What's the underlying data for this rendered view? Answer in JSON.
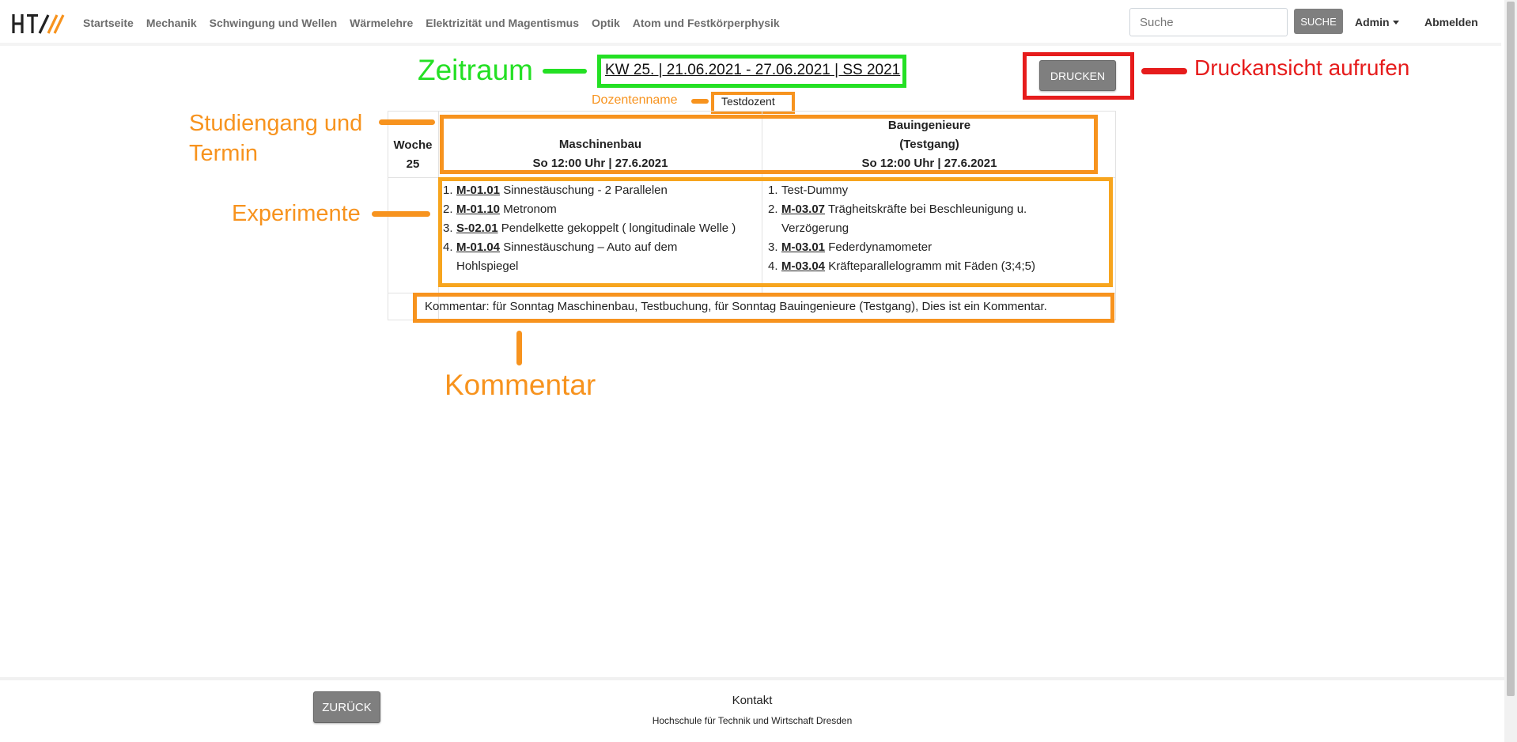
{
  "nav": {
    "links": [
      "Startseite",
      "Mechanik",
      "Schwingung und Wellen",
      "Wärmelehre",
      "Elektrizität und Magentismus",
      "Optik",
      "Atom und Festkörperphysik"
    ],
    "search_placeholder": "Suche",
    "search_button": "SUCHE",
    "admin": "Admin",
    "logout": "Abmelden"
  },
  "header": {
    "zeitraum": "KW 25. | 21.06.2021 - 27.06.2021 | SS 2021",
    "print_button": "DRUCKEN",
    "dozent": "Testdozent"
  },
  "annotations": {
    "zeitraum": "Zeitraum",
    "druck": "Druckansicht aufrufen",
    "dozentenname": "Dozentenname",
    "studiengang_1": "Studiengang und",
    "studiengang_2": "Termin",
    "experimente": "Experimente",
    "kommentar": "Kommentar"
  },
  "table": {
    "week_label": "Woche",
    "week_number": "25",
    "columns": [
      {
        "name_lines": [
          "",
          "Maschinenbau"
        ],
        "termin": "So 12:00 Uhr | 27.6.2021",
        "experiments": [
          {
            "num": "1.",
            "code": "M-01.01",
            "title": "Sinnestäuschung - 2 Parallelen"
          },
          {
            "num": "2.",
            "code": "M-01.10",
            "title": "Metronom"
          },
          {
            "num": "3.",
            "code": "S-02.01",
            "title": "Pendelkette gekoppelt ( longitudinale Welle )"
          },
          {
            "num": "4.",
            "code": "M-01.04",
            "title": "Sinnestäuschung – Auto auf dem Hohlspiegel"
          }
        ]
      },
      {
        "name_lines": [
          "Bauingenieure",
          "(Testgang)"
        ],
        "termin": "So 12:00 Uhr | 27.6.2021",
        "experiments": [
          {
            "num": "1.",
            "code": "",
            "title": "Test-Dummy"
          },
          {
            "num": "2.",
            "code": "M-03.07",
            "title": "Trägheitskräfte bei Beschleunigung u. Verzögerung"
          },
          {
            "num": "3.",
            "code": "M-03.01",
            "title": "Federdynamometer"
          },
          {
            "num": "4.",
            "code": "M-03.04",
            "title": "Kräfteparallelogramm mit Fäden (3;4;5)"
          }
        ]
      }
    ],
    "comment": "Kommentar: für Sonntag Maschinenbau, Testbuchung, für Sonntag Bauingenieure (Testgang), Dies ist ein Kommentar."
  },
  "footer": {
    "back_button": "ZURÜCK",
    "kontakt": "Kontakt",
    "hochschule": "Hochschule für Technik und Wirtschaft Dresden"
  },
  "colors": {
    "green": "#24e024",
    "red": "#e61c1c",
    "orange": "#f7931e",
    "button_gray": "#7f7f7f"
  }
}
